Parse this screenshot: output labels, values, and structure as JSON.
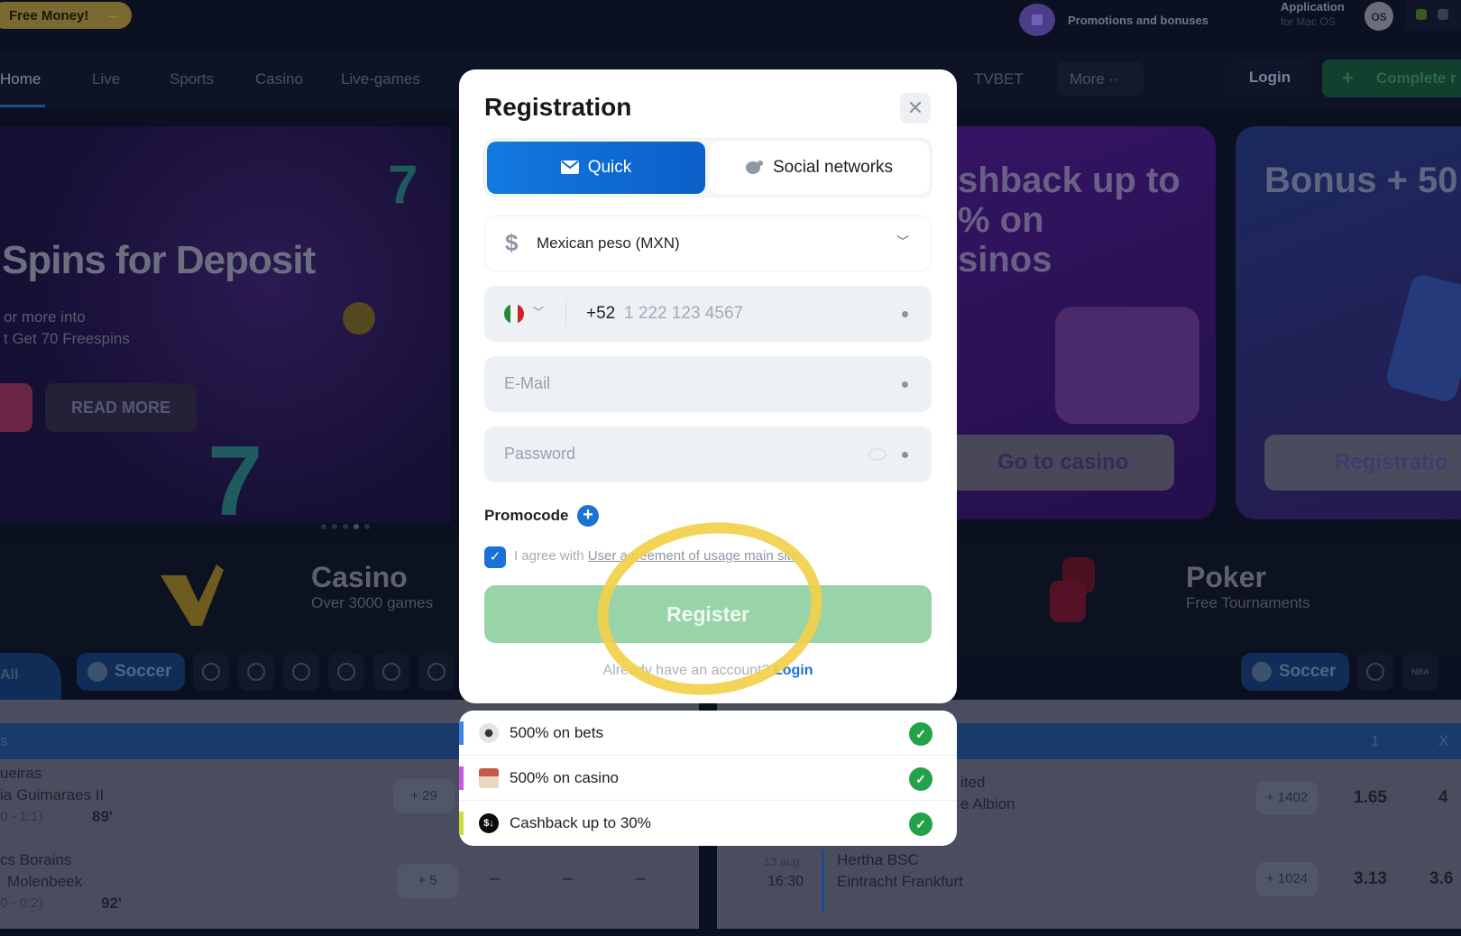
{
  "topbar": {
    "free_money": "Free Money!",
    "promotions": "Promotions and bonuses",
    "app_title": "Application",
    "app_sub": "for Mac OS",
    "macos_badge": "OS"
  },
  "nav": {
    "items": [
      "Home",
      "Live",
      "Sports",
      "Casino",
      "Live-games",
      "TVBET"
    ],
    "active": "Home",
    "more": "More",
    "login": "Login",
    "complete": "Complete r"
  },
  "hero": {
    "title": "Spins for Deposit",
    "sub_line1": "or more into",
    "sub_line2": "t Get 70 Freespins",
    "read_more": "READ MORE"
  },
  "cards": [
    {
      "title_l1": "shback up to",
      "title_l2": "% on",
      "title_l3": "sinos",
      "button": "Go to casino"
    },
    {
      "title": "Bonus + 50",
      "button": "Registratio"
    }
  ],
  "categories": {
    "casino_title": "Casino",
    "casino_sub": "Over 3000 games",
    "poker_title": "Poker",
    "poker_sub": "Free Tournaments"
  },
  "sports_bar": {
    "all": "All",
    "soccer": "Soccer",
    "soccer_right": "Soccer",
    "nba": "NBA"
  },
  "table_left": {
    "header": "s",
    "rows": [
      {
        "team1": "ueiras",
        "team2": "ia Guimaraes II",
        "score": "0 - 1:1)",
        "minute": "89'",
        "more": "+ 29"
      },
      {
        "team1": "cs Borains",
        "team2": "Molenbeek",
        "score": "0 - 0:2)",
        "minute": "92'",
        "more": "+ 5",
        "odds": [
          "–",
          "–",
          "–"
        ]
      }
    ]
  },
  "table_right": {
    "col1": "1",
    "colx": "X",
    "rows": [
      {
        "team1": "ited",
        "team2": "e Albion",
        "more": "+ 1402",
        "odd1": "1.65",
        "oddx": "4"
      },
      {
        "date": "13 aug",
        "time": "16:30",
        "team1": "Hertha BSC",
        "team2": "Eintracht Frankfurt",
        "more": "+ 1024",
        "odd1": "3.13",
        "oddx": "3.6"
      }
    ]
  },
  "modal": {
    "title": "Registration",
    "tabs": [
      {
        "label": "Quick",
        "icon": "envelope-icon",
        "active": true
      },
      {
        "label": "Social networks",
        "icon": "chat-bubbles-icon",
        "active": false
      }
    ],
    "currency": {
      "symbol": "$",
      "value": "Mexican peso (MXN)"
    },
    "phone": {
      "prefix": "+52",
      "placeholder": "1 222 123 4567",
      "country": "Mexico"
    },
    "email_placeholder": "E-Mail",
    "password_placeholder": "Password",
    "promocode_label": "Promocode",
    "agree_prefix": "I agree with ",
    "agree_link": "User agreement of usage main site",
    "agree_checked": true,
    "register": "Register",
    "have_account": "Already have an account? ",
    "login_link": "Login"
  },
  "bonuses": [
    {
      "label": "500% on bets",
      "icon": "soccer-ball-icon",
      "color": "#3a86e6"
    },
    {
      "label": "500% on casino",
      "icon": "casino-building-icon",
      "color": "#c45be0"
    },
    {
      "label": "Cashback up to 30%",
      "icon": "cashback-icon",
      "color": "#c8de3a"
    }
  ],
  "colors": {
    "accent_blue": "#1279e0",
    "register_green": "#98d4a8",
    "check_green": "#22a34a",
    "highlight_yellow": "#f2d04b"
  }
}
